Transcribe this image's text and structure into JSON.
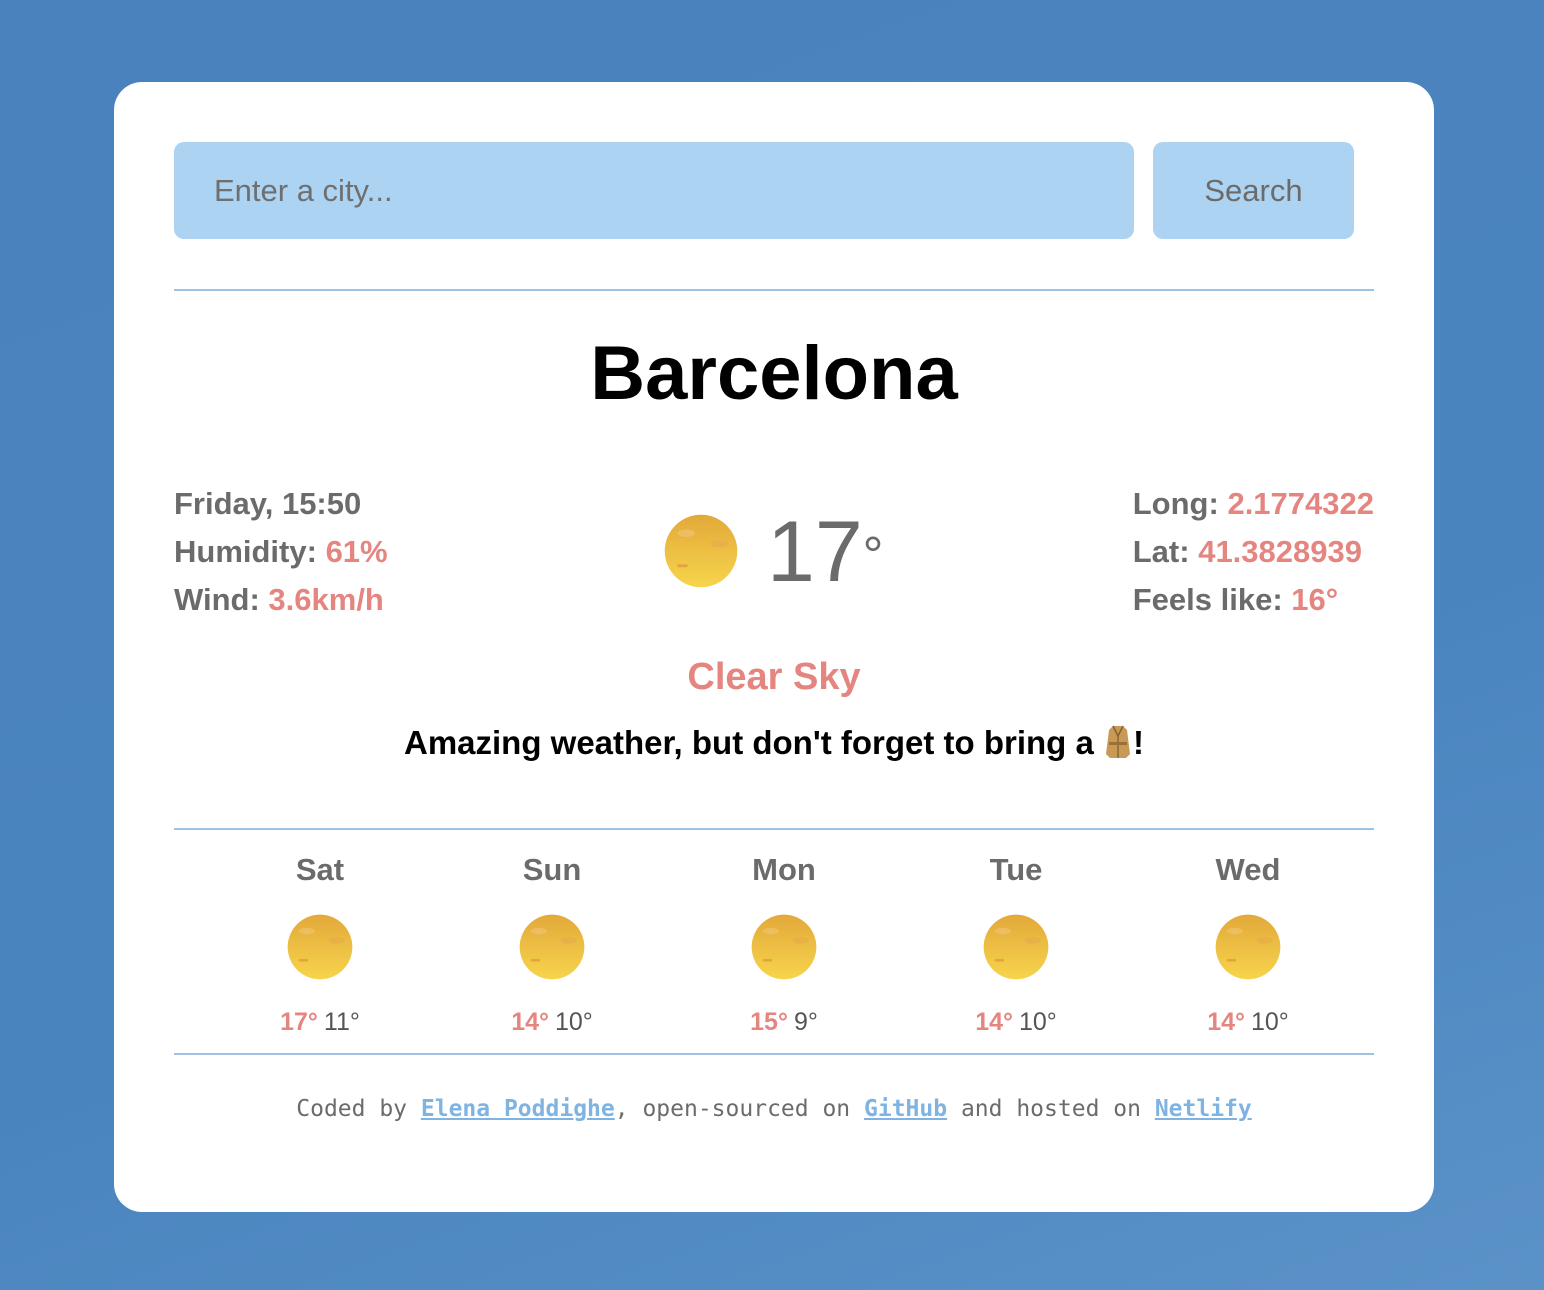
{
  "search": {
    "placeholder": "Enter a city...",
    "button_label": "Search"
  },
  "city": "Barcelona",
  "left_details": {
    "datetime": "Friday, 15:50",
    "humidity_label": "Humidity:",
    "humidity_value": "61%",
    "wind_label": "Wind:",
    "wind_value": "3.6km/h"
  },
  "current": {
    "icon": "sun-icon",
    "temperature": "17",
    "degree": "°"
  },
  "right_details": {
    "long_label": "Long:",
    "long_value": "2.1774322",
    "lat_label": "Lat:",
    "lat_value": "41.3828939",
    "feels_label": "Feels like:",
    "feels_value": "16°"
  },
  "description": "Clear Sky",
  "message": {
    "text_before": "Amazing weather, but don't forget to bring a",
    "icon": "coat-icon",
    "text_after": "!"
  },
  "forecast": [
    {
      "day": "Sat",
      "icon": "sun-icon",
      "max": "17°",
      "min": "11°"
    },
    {
      "day": "Sun",
      "icon": "sun-icon",
      "max": "14°",
      "min": "10°"
    },
    {
      "day": "Mon",
      "icon": "sun-icon",
      "max": "15°",
      "min": "9°"
    },
    {
      "day": "Tue",
      "icon": "sun-icon",
      "max": "14°",
      "min": "10°"
    },
    {
      "day": "Wed",
      "icon": "sun-icon",
      "max": "14°",
      "min": "10°"
    }
  ],
  "footer": {
    "part1": "Coded by ",
    "author": "Elena Poddighe",
    "part2": ", open-sourced on ",
    "github": "GitHub",
    "part3": " and hosted on ",
    "netlify": "Netlify"
  },
  "colors": {
    "background": "#4a84bf",
    "input_bg": "#acd3f2",
    "accent": "#e58580",
    "link": "#7fb3e2"
  }
}
